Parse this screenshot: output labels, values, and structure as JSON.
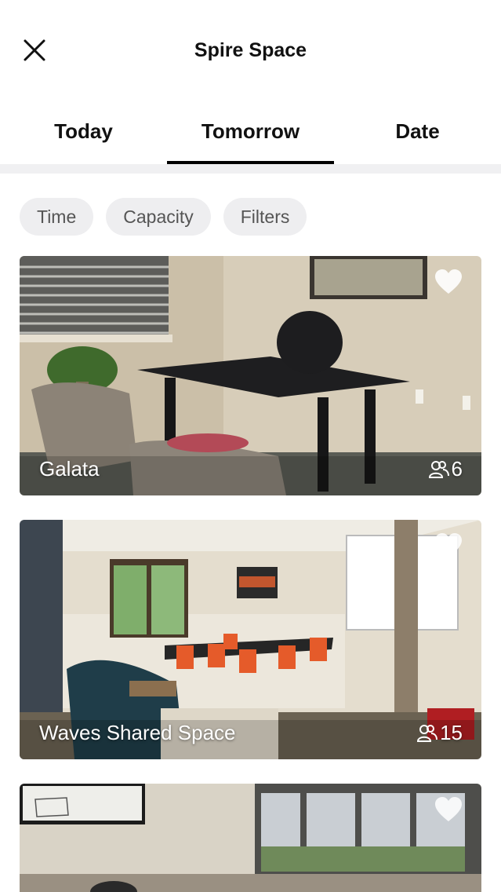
{
  "header": {
    "title": "Spire Space",
    "close_icon": "close-icon"
  },
  "tabs": [
    {
      "label": "Today"
    },
    {
      "label": "Tomorrow",
      "active": true
    },
    {
      "label": "Date"
    }
  ],
  "filters": [
    {
      "label": "Time"
    },
    {
      "label": "Capacity"
    },
    {
      "label": "Filters"
    }
  ],
  "spaces": [
    {
      "name": "Galata",
      "capacity": "6",
      "favorite_icon": "heart-icon",
      "capacity_icon": "people-icon"
    },
    {
      "name": "Waves Shared Space",
      "capacity": "15",
      "favorite_icon": "heart-icon",
      "capacity_icon": "people-icon"
    },
    {
      "name": "",
      "capacity": "",
      "favorite_icon": "heart-icon"
    }
  ],
  "colors": {
    "accent": "#000000",
    "chip_bg": "#eeeef0",
    "separator": "#f0f0f2"
  }
}
